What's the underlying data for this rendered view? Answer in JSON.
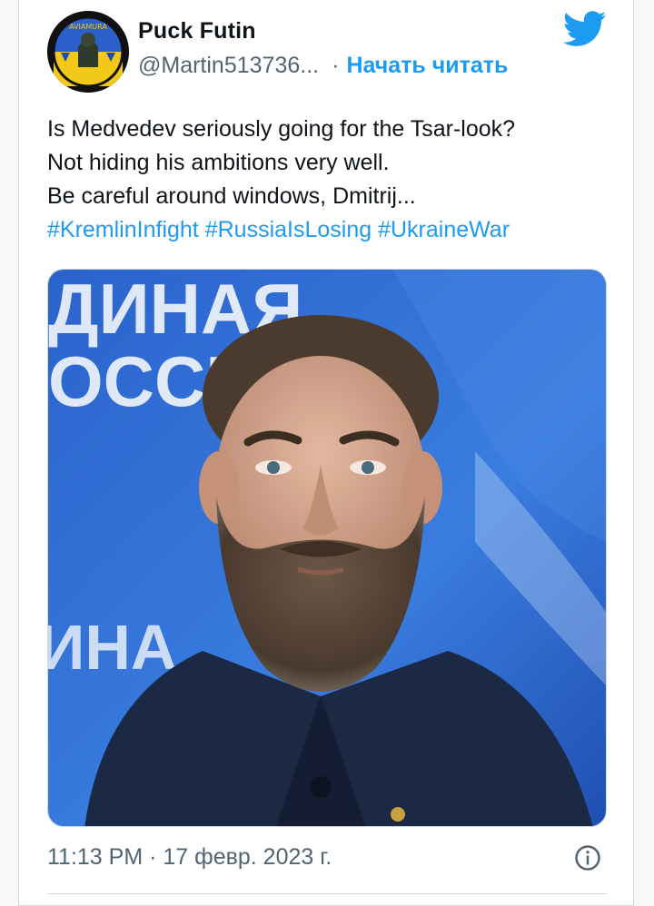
{
  "user": {
    "display_name": "Puck Futin",
    "handle": "@Martin513736...",
    "separator": "·",
    "follow_label": "Начать читать",
    "avatar_badge_text": "AVIAMURA"
  },
  "tweet": {
    "lines": [
      "Is Medvedev seriously going for the Tsar-look?",
      "Not hiding his ambitions very well.",
      "Be careful around windows, Dmitrij..."
    ],
    "hashtags": [
      "#KremlinInfight",
      "#RussiaIsLosing",
      "#UkraineWar"
    ]
  },
  "media": {
    "background_text_top": "ДИНАЯ",
    "background_text_mid": "ОССИ",
    "background_text_low": "ИНА",
    "colors": {
      "background_blue": "#2f6fd4",
      "suit": "#1d2a44",
      "beard": "#4b3a2c"
    }
  },
  "footer": {
    "timestamp": "11:13 PM · 17 февр. 2023 г."
  },
  "colors": {
    "accent": "#1d9bf0",
    "secondary_text": "#536471",
    "primary_text": "#0f1419"
  },
  "icons": {
    "logo": "twitter-bird-icon",
    "info": "info-icon"
  }
}
